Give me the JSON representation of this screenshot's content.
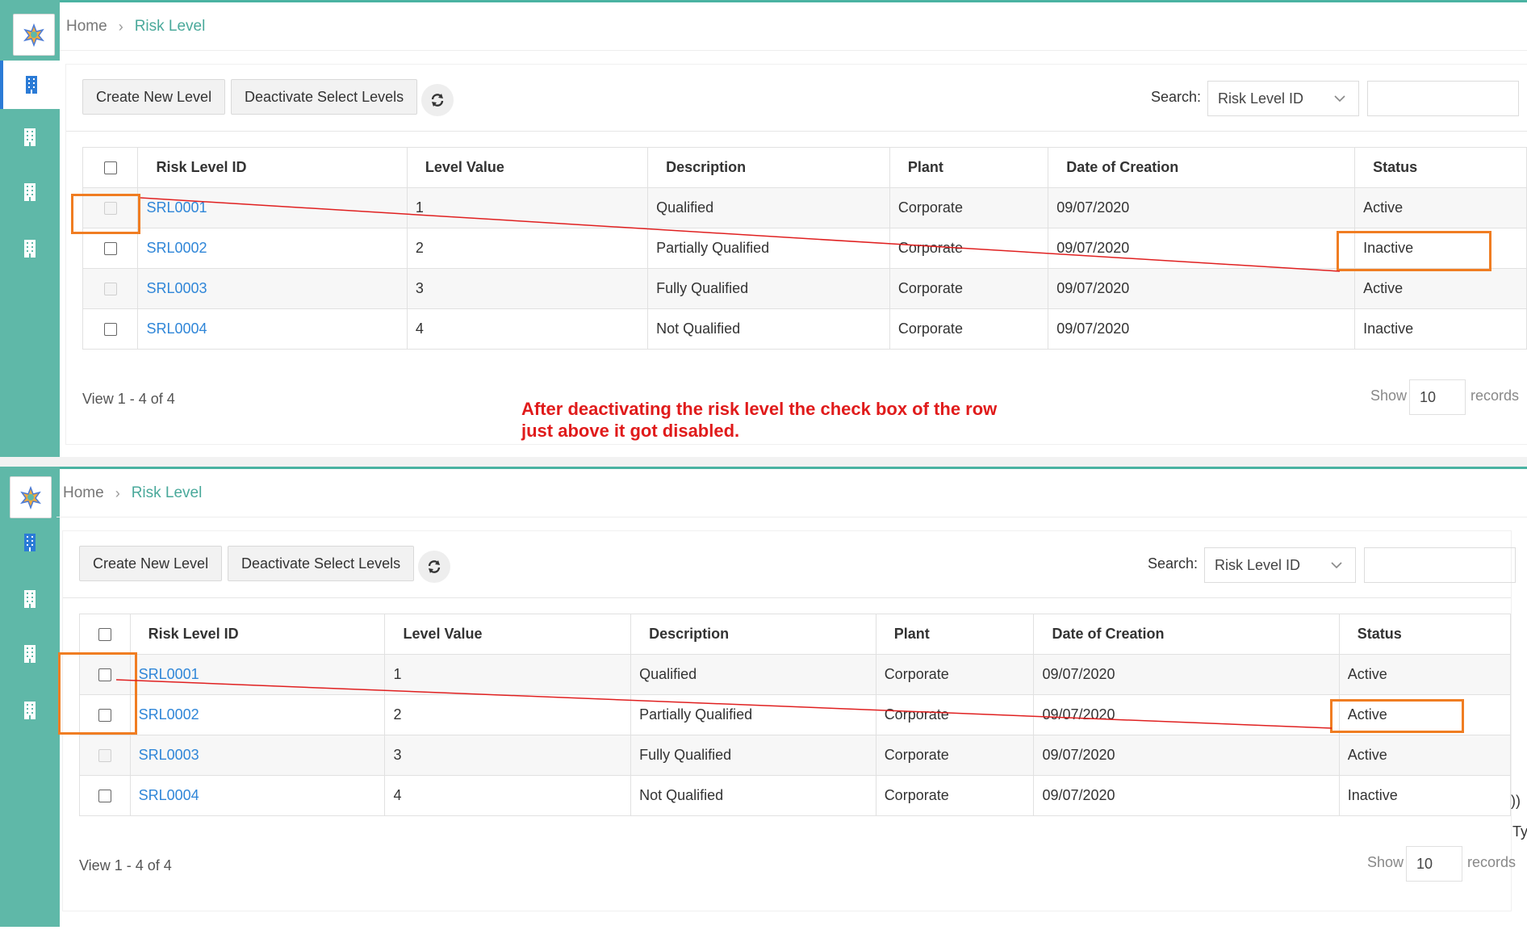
{
  "breadcrumb": {
    "home": "Home",
    "current": "Risk Level"
  },
  "toolbar": {
    "create_label": "Create New Level",
    "deactivate_label": "Deactivate Select Levels",
    "search_label": "Search:",
    "search_field": "Risk Level ID"
  },
  "table": {
    "headers": [
      "Risk Level ID",
      "Level Value",
      "Description",
      "Plant",
      "Date of Creation",
      "Status"
    ]
  },
  "panel_before": {
    "rows": [
      {
        "id": "SRL0001",
        "value": "1",
        "description": "Qualified",
        "plant": "Corporate",
        "date": "09/07/2020",
        "status": "Active",
        "checkbox_disabled": true
      },
      {
        "id": "SRL0002",
        "value": "2",
        "description": "Partially Qualified",
        "plant": "Corporate",
        "date": "09/07/2020",
        "status": "Inactive",
        "checkbox_disabled": false
      },
      {
        "id": "SRL0003",
        "value": "3",
        "description": "Fully Qualified",
        "plant": "Corporate",
        "date": "09/07/2020",
        "status": "Active",
        "checkbox_disabled": true
      },
      {
        "id": "SRL0004",
        "value": "4",
        "description": "Not Qualified",
        "plant": "Corporate",
        "date": "09/07/2020",
        "status": "Inactive",
        "checkbox_disabled": false
      }
    ]
  },
  "panel_after": {
    "rows": [
      {
        "id": "SRL0001",
        "value": "1",
        "description": "Qualified",
        "plant": "Corporate",
        "date": "09/07/2020",
        "status": "Active",
        "checkbox_disabled": false
      },
      {
        "id": "SRL0002",
        "value": "2",
        "description": "Partially Qualified",
        "plant": "Corporate",
        "date": "09/07/2020",
        "status": "Active",
        "checkbox_disabled": false
      },
      {
        "id": "SRL0003",
        "value": "3",
        "description": "Fully Qualified",
        "plant": "Corporate",
        "date": "09/07/2020",
        "status": "Active",
        "checkbox_disabled": true
      },
      {
        "id": "SRL0004",
        "value": "4",
        "description": "Not Qualified",
        "plant": "Corporate",
        "date": "09/07/2020",
        "status": "Inactive",
        "checkbox_disabled": false
      }
    ]
  },
  "footer": {
    "view_text": "View 1 - 4 of 4",
    "show_label": "Show",
    "page_size": "10",
    "records_label": "records"
  },
  "annotation": {
    "line1": "After deactivating the risk level the check box of the row",
    "line2": "just above it got disabled."
  },
  "edge_fragments": {
    "a": "))",
    "b": "Ty"
  },
  "colors": {
    "sidebar": "#5fb8a8",
    "accent_teal": "#4aa99b",
    "link_blue": "#2f86d8",
    "highlight_orange": "#f07d22",
    "annotation_red": "#e01b1b",
    "line_red": "#e02020"
  },
  "icons": {
    "logo": "colorful-star-logo-icon",
    "nav": "building-icon",
    "refresh": "refresh-icon",
    "dropdown": "chevron-down-icon",
    "breadcrumb_separator": "chevron-right-icon"
  }
}
